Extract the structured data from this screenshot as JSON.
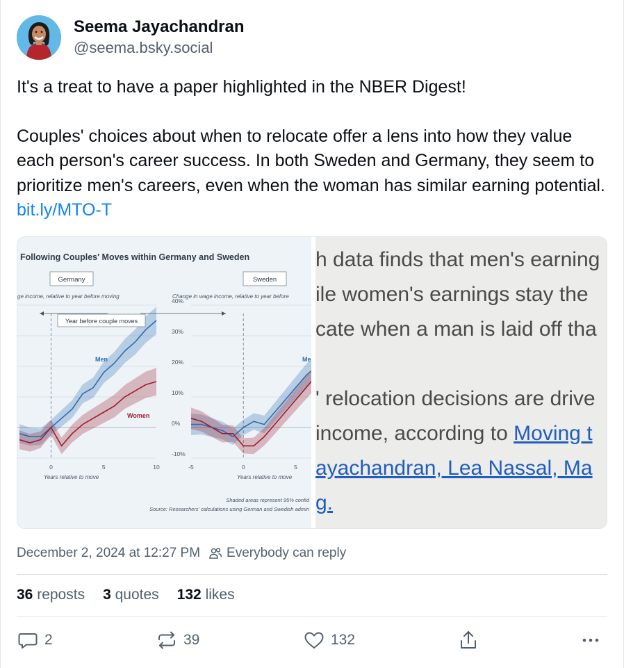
{
  "author": {
    "display_name": "Seema Jayachandran",
    "handle": "@seema.bsky.social"
  },
  "post": {
    "paragraph1": "It's a treat to have a paper highlighted in the NBER Digest!",
    "paragraph2": "Couples' choices about when to relocate offer a lens into how they value each person's career success. In both Sweden and Germany, they seem to prioritize men's careers, even when the woman has similar earning potential. ",
    "link": "bit.ly/MTO-T"
  },
  "figure": {
    "title": "Following Couples' Moves within Germany and Sweden",
    "panel_germany": "Germany",
    "panel_sweden": "Sweden",
    "ylabel_left": "ge income, relative to year before moving",
    "ylabel_right": "Change in wage income, relative to year before",
    "annotation": "Year before couple moves",
    "series_men": "Men",
    "series_men_right": "Me",
    "series_women": "Women",
    "xlabel_left": "Years relative to move",
    "xlabel_right": "Years relative to move",
    "ticks_y": [
      "40%",
      "30%",
      "20%",
      "10%",
      "0%",
      "-10%"
    ],
    "ticks_x_left": [
      "0",
      "5",
      "10"
    ],
    "ticks_x_right": [
      "-5",
      "0",
      "5"
    ],
    "note1": "Shaded areas represent 95% confid",
    "note2": "Source: Researchers' calculations using German and Swedish admin"
  },
  "chart_data": [
    {
      "type": "line",
      "title": "Germany",
      "xlabel": "Years relative to move",
      "ylabel": "ge income, relative to year before moving",
      "x": [
        -3,
        -2,
        -1,
        0,
        1,
        2,
        3,
        4,
        5,
        6,
        7,
        8,
        9,
        10
      ],
      "ylim": [
        -10,
        40
      ],
      "series": [
        {
          "name": "Men",
          "values": [
            -2,
            -3,
            -3,
            0,
            3,
            6,
            11,
            13,
            18,
            21,
            25,
            28,
            32,
            35
          ],
          "color": "#2b6cb0"
        },
        {
          "name": "Women",
          "values": [
            -4,
            -5,
            -4,
            0,
            -6,
            -2,
            1,
            3,
            5,
            7,
            10,
            12,
            14,
            15
          ],
          "color": "#9b1c2c"
        }
      ]
    },
    {
      "type": "line",
      "title": "Sweden",
      "xlabel": "Years relative to move",
      "ylabel": "Change in wage income, relative to year before",
      "x": [
        -5,
        -4,
        -3,
        -2,
        -1,
        0,
        1,
        2,
        3,
        4,
        5,
        6,
        7
      ],
      "ylim": [
        -10,
        40
      ],
      "series": [
        {
          "name": "Men",
          "values": [
            1,
            1,
            0,
            -1,
            -3,
            0,
            2,
            1,
            5,
            9,
            13,
            17,
            20
          ],
          "color": "#2b6cb0"
        },
        {
          "name": "Women",
          "values": [
            3,
            2,
            0,
            -2,
            -2,
            -6,
            -6,
            -3,
            1,
            5,
            9,
            13,
            17
          ],
          "color": "#9b1c2c"
        }
      ]
    }
  ],
  "screenshot_lines": [
    {
      "text": "h data finds that men's earning",
      "link": ""
    },
    {
      "text": "ile women's earnings stay the",
      "link": ""
    },
    {
      "text": "cate when a man is laid off tha",
      "link": ""
    },
    {
      "text": "' relocation decisions are drive",
      "link": ""
    },
    {
      "text": "income, according to ",
      "link": "Moving t"
    },
    {
      "text": "",
      "link": "ayachandran, Lea Nassal, Ma"
    },
    {
      "text": "",
      "link": "g."
    }
  ],
  "meta": {
    "timestamp": "December 2, 2024 at 12:27 PM",
    "reply_setting": "Everybody can reply"
  },
  "stats": {
    "reposts_count": "36",
    "reposts_label": "reposts",
    "quotes_count": "3",
    "quotes_label": "quotes",
    "likes_count": "132",
    "likes_label": "likes"
  },
  "actions": {
    "reply_count": "2",
    "repost_count": "39",
    "like_count": "132"
  },
  "colors": {
    "link": "#1083fe",
    "muted": "#52606d",
    "men": "#2b6cb0",
    "women": "#9b1c2c"
  }
}
